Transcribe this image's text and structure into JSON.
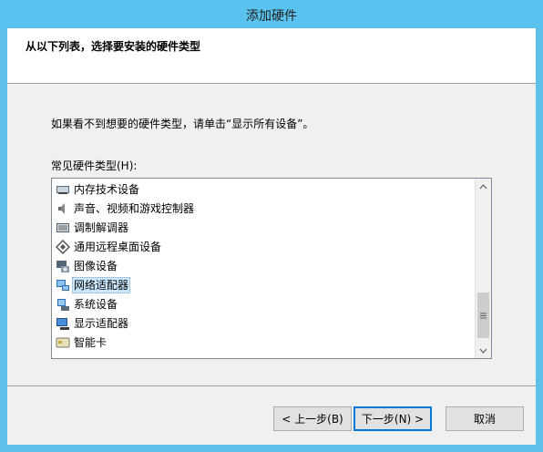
{
  "window": {
    "title": "添加硬件"
  },
  "header": {
    "text": "从以下列表，选择要安装的硬件类型"
  },
  "info": "如果看不到想要的硬件类型，请单击“显示所有设备”。",
  "list_label": "常见硬件类型(H):",
  "items": [
    {
      "label": "内存技术设备",
      "icon": "memory-card-icon"
    },
    {
      "label": "声音、视频和游戏控制器",
      "icon": "speaker-icon"
    },
    {
      "label": "调制解调器",
      "icon": "modem-icon"
    },
    {
      "label": "通用远程桌面设备",
      "icon": "remote-desktop-icon"
    },
    {
      "label": "图像设备",
      "icon": "camera-icon"
    },
    {
      "label": "网络适配器",
      "icon": "network-adapter-icon",
      "selected": true
    },
    {
      "label": "系统设备",
      "icon": "system-device-icon"
    },
    {
      "label": "显示适配器",
      "icon": "display-adapter-icon"
    },
    {
      "label": "智能卡",
      "icon": "smart-card-icon"
    }
  ],
  "buttons": {
    "back": "< 上一步(B)",
    "next": "下一步(N) >",
    "cancel": "取消"
  }
}
